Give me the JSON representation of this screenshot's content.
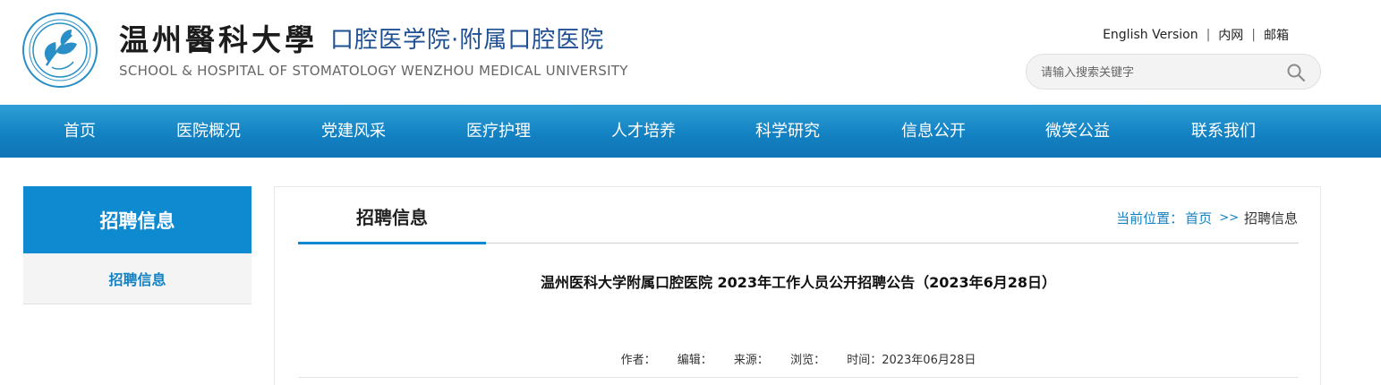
{
  "header": {
    "university_name": "温州醫科大學",
    "school_name": "口腔医学院·附属口腔医院",
    "english_name": "SCHOOL & HOSPITAL OF STOMATOLOGY WENZHOU MEDICAL UNIVERSITY",
    "links": [
      "English Version",
      "内网",
      "邮箱"
    ],
    "search_placeholder": "请输入搜索关键字"
  },
  "nav": {
    "items": [
      "首页",
      "医院概况",
      "党建风采",
      "医疗护理",
      "人才培养",
      "科学研究",
      "信息公开",
      "微笑公益",
      "联系我们"
    ]
  },
  "sidebar": {
    "title": "招聘信息",
    "items": [
      "招聘信息"
    ]
  },
  "main": {
    "tab_label": "招聘信息",
    "breadcrumb": {
      "prefix": "当前位置：",
      "home": "首页",
      "separator": ">>",
      "current": "招聘信息"
    },
    "article": {
      "title": "温州医科大学附属口腔医院 2023年工作人员公开招聘公告（2023年6月28日）",
      "meta": {
        "author": "作者：",
        "editor": "编辑：",
        "source": "来源：",
        "views": "浏览：",
        "time": "时间：2023年06月28日"
      }
    }
  },
  "colors": {
    "brand_blue": "#0e8ad0",
    "nav_gradient_top": "#2f9fd6",
    "nav_gradient_bottom": "#0f74b3",
    "school_name": "#1f4f93"
  }
}
